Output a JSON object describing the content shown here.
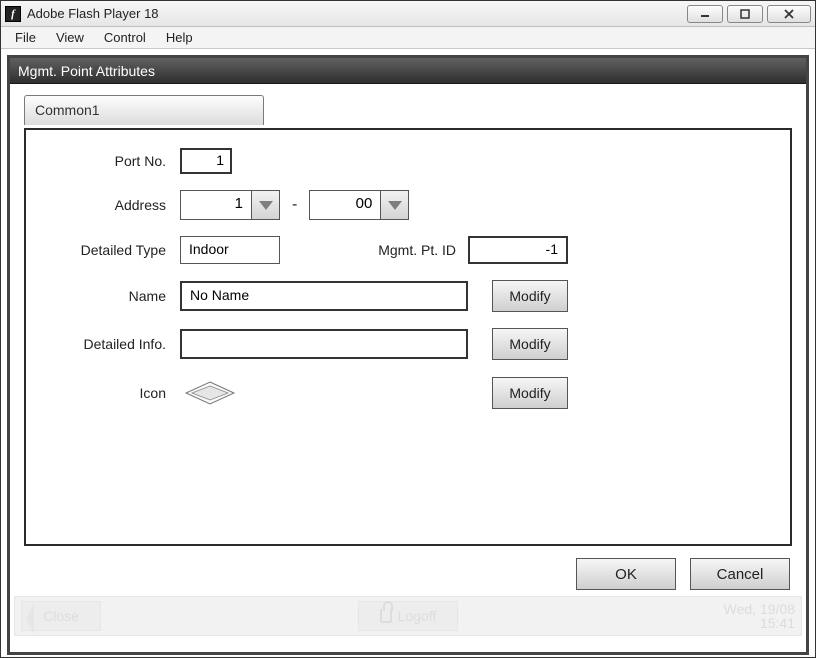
{
  "window": {
    "title": "Adobe Flash Player 18",
    "app_icon_glyph": "f"
  },
  "menu": {
    "file": "File",
    "view": "View",
    "control": "Control",
    "help": "Help"
  },
  "dialog": {
    "title": "Mgmt. Point Attributes",
    "tab_label": "Common1",
    "labels": {
      "port_no": "Port No.",
      "address": "Address",
      "detailed_type": "Detailed Type",
      "mgmt_pt_id": "Mgmt. Pt. ID",
      "name": "Name",
      "detailed_info": "Detailed Info.",
      "icon": "Icon"
    },
    "values": {
      "port_no": "1",
      "address_main": "1",
      "address_sub": "00",
      "detailed_type": "Indoor",
      "mgmt_pt_id": "-1",
      "name": "No Name",
      "detailed_info": ""
    },
    "buttons": {
      "modify": "Modify",
      "ok": "OK",
      "cancel": "Cancel"
    }
  },
  "status": {
    "close": "Close",
    "logoff": "Logoff",
    "date": "Wed, 19/08",
    "time": "15:41"
  }
}
